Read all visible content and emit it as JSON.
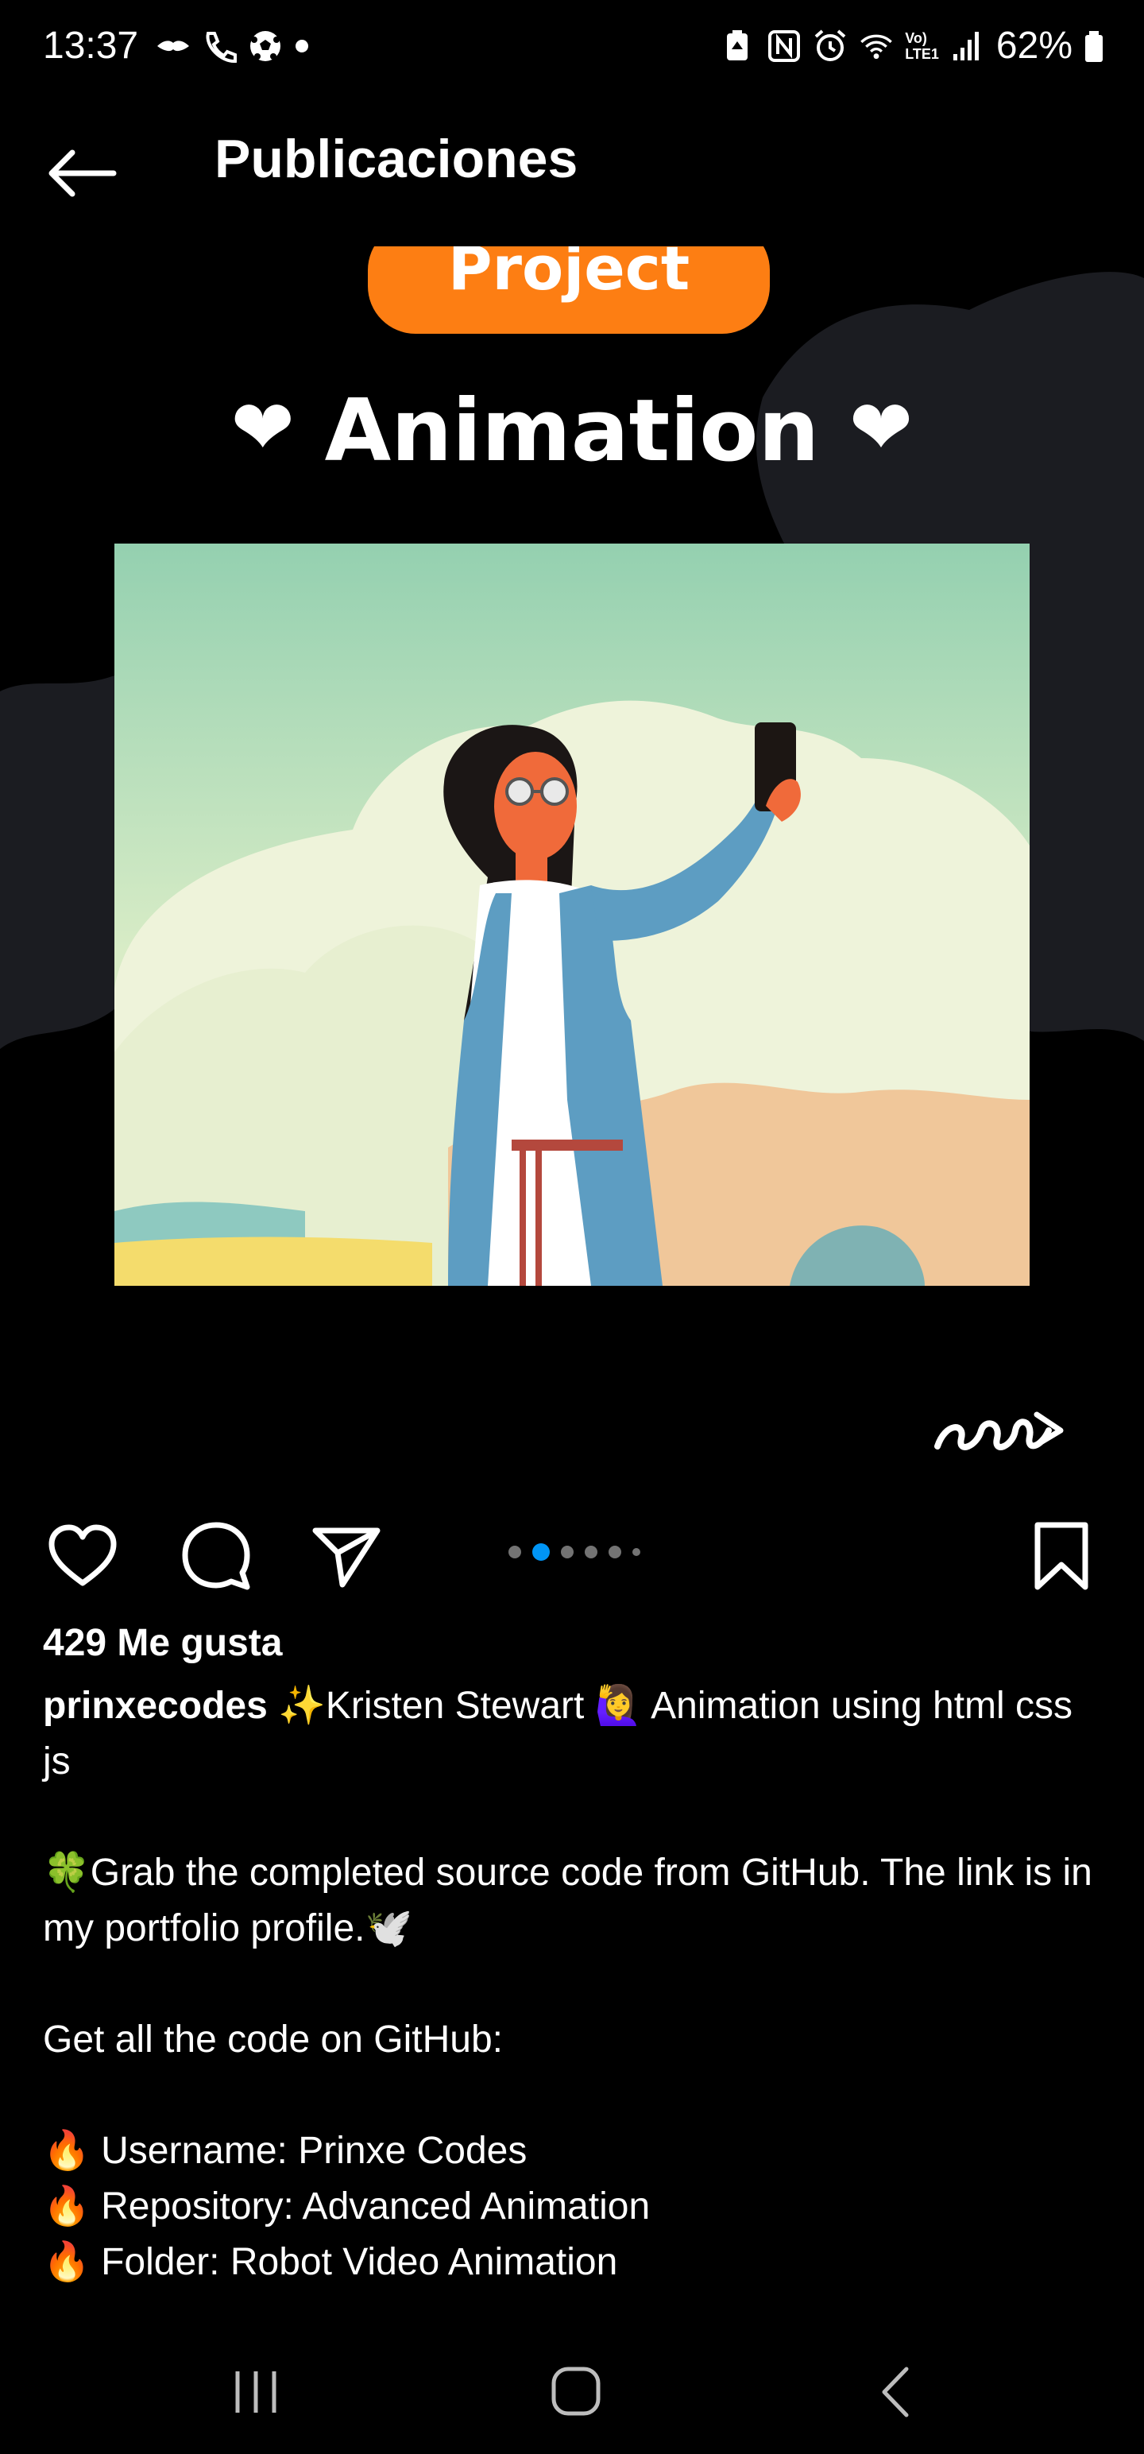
{
  "status_bar": {
    "time": "13:37",
    "battery": "62%",
    "network_label_top": "Vo)",
    "network_label_bottom": "LTE1"
  },
  "header": {
    "title": "Publicaciones"
  },
  "media": {
    "pill_text": "Project",
    "title_text": "Animation",
    "heart_glyph": "❤"
  },
  "carousel": {
    "total": 6,
    "active_index": 1
  },
  "post": {
    "likes": "429 Me gusta",
    "username": "prinxecodes",
    "caption_first": "✨Kristen Stewart 🙋‍♀️ Animation using html css js",
    "caption_line2": "🍀Grab the completed source code from GitHub. The link is in my portfolio profile.🕊️",
    "caption_line3": "Get all the code on GitHub:",
    "caption_line4": "🔥 Username: Prinxe Codes",
    "caption_line5": "🔥 Repository: Advanced Animation",
    "caption_line6": "🔥 Folder: Robot Video Animation"
  },
  "colors": {
    "accent_blue": "#0095f6",
    "pill_orange": "#fd7e13",
    "background": "#000000"
  },
  "icons": [
    "back-arrow-icon",
    "heart-icon",
    "comment-icon",
    "share-icon",
    "bookmark-icon",
    "recents-icon",
    "home-icon",
    "back-icon"
  ]
}
